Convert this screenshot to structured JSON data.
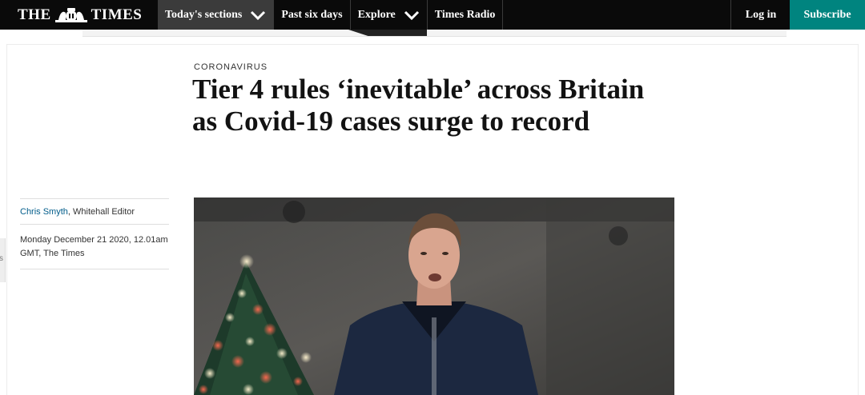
{
  "masthead": {
    "logo_left": "THE",
    "logo_right": "TIMES"
  },
  "nav": {
    "items": [
      {
        "label": "Today's sections",
        "has_dropdown": true
      },
      {
        "label": "Past six days",
        "has_dropdown": false
      },
      {
        "label": "Explore",
        "has_dropdown": true
      },
      {
        "label": "Times Radio",
        "has_dropdown": false
      }
    ],
    "login_label": "Log in",
    "subscribe_label": "Subscribe"
  },
  "colors": {
    "bar": "#0a0a0a",
    "active_nav": "#3b3b3b",
    "subscribe": "#00847f",
    "author_link": "#005c8a"
  },
  "edge_tab": "s",
  "article": {
    "kicker": "CORONAVIRUS",
    "headline": "Tier 4 rules ‘inevitable’ across Britain as Covid-19 cases surge to record",
    "author_name": "Chris Smyth",
    "author_role": ", Whitehall Editor",
    "dateline": "Monday December 21 2020, 12.01am GMT, The Times"
  }
}
